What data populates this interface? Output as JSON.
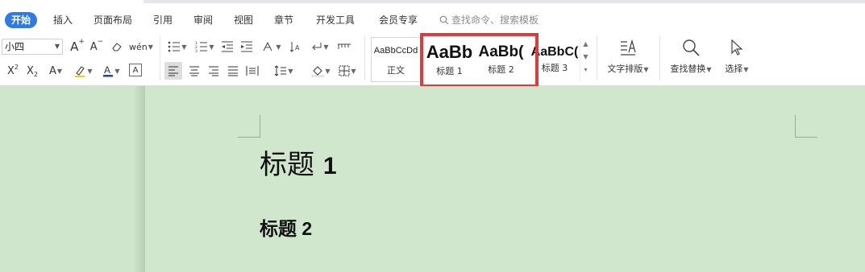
{
  "tabs": [
    "开始",
    "插入",
    "页面布局",
    "引用",
    "审阅",
    "视图",
    "章节",
    "开发工具",
    "会员专享"
  ],
  "search_hint": "查找命令、搜索模板",
  "font_size": "小四",
  "toolbar": {
    "wen_label": "wén",
    "align_left_active": true
  },
  "styles": [
    {
      "sample": "AaBbCcDd",
      "caption": "正文"
    },
    {
      "sample": "AaBb",
      "caption": "标题 1"
    },
    {
      "sample": "AaBb(",
      "caption": "标题 2"
    },
    {
      "sample": "AaBbC(",
      "caption": "标题 3"
    }
  ],
  "big_tools": {
    "text_layout": "文字排版",
    "find_replace": "查找替换",
    "select": "选择"
  },
  "document": {
    "heading1_text": "标题",
    "heading1_num": "1",
    "heading2": "标题 2"
  },
  "colors": {
    "accent": "#2f7ae5",
    "highlight": "#e03a3a",
    "doc_background": "#d0e7ce",
    "font_color_bar": "#1f3fbf"
  }
}
